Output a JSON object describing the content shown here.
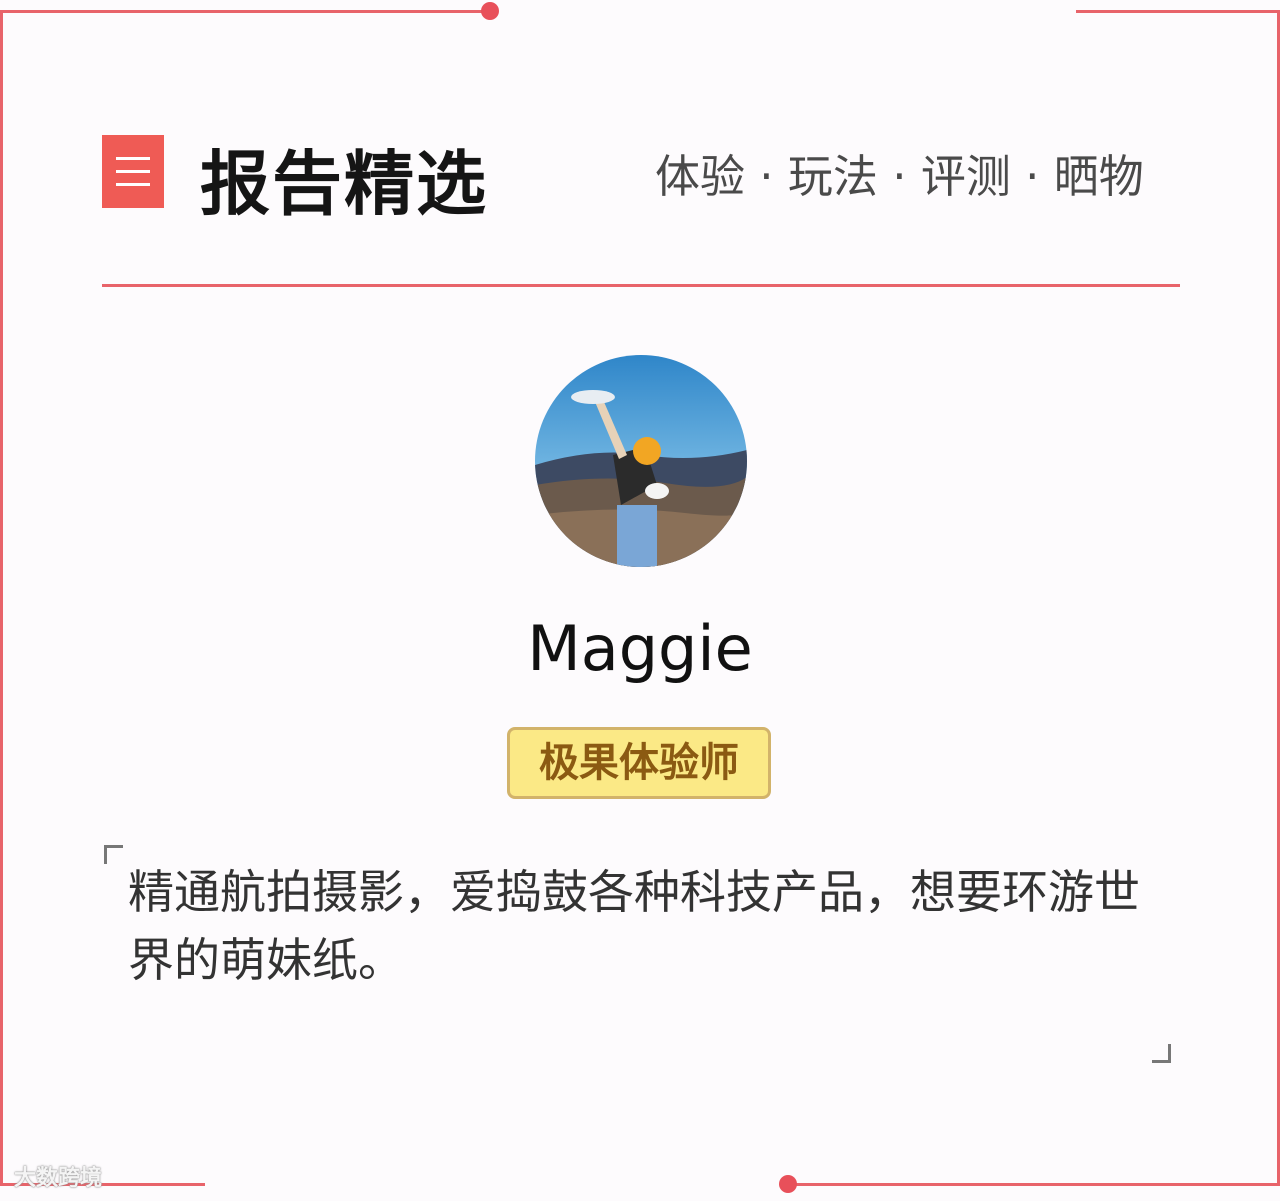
{
  "header": {
    "title": "报告精选",
    "tags": "体验 · 玩法 · 评测 · 晒物"
  },
  "profile": {
    "name": "Maggie",
    "role": "极果体验师",
    "bio": "精通航拍摄影，爱捣鼓各种科技产品，想要环游世界的萌妹纸。"
  },
  "watermark": "大数跨境",
  "icons": {
    "menu": "menu-icon",
    "avatar": "profile-photo"
  },
  "colors": {
    "accent": "#e8636a",
    "badge_fill": "#fbe986",
    "badge_text": "#8b5a12"
  }
}
